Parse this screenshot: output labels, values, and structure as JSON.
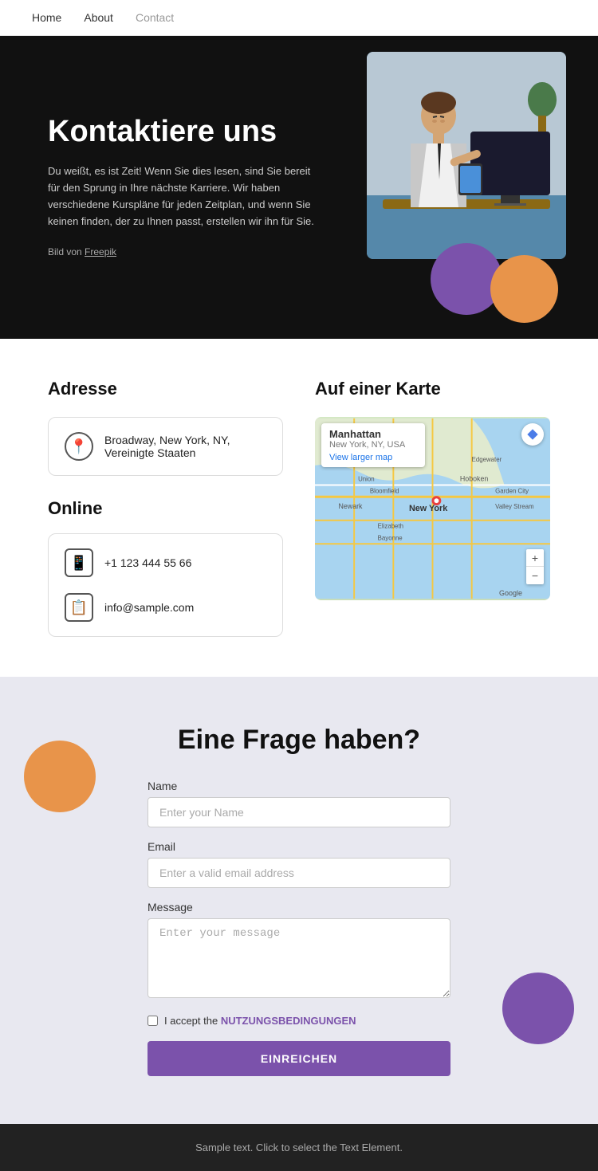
{
  "nav": {
    "links": [
      {
        "label": "Home",
        "active": false
      },
      {
        "label": "About",
        "active": false
      },
      {
        "label": "Contact",
        "active": true
      }
    ]
  },
  "hero": {
    "title": "Kontaktiere uns",
    "body": "Du weißt, es ist Zeit! Wenn Sie dies lesen, sind Sie bereit für den Sprung in Ihre nächste Karriere. Wir haben verschiedene Kurspläne für jeden Zeitplan, und wenn Sie keinen finden, der zu Ihnen passt, erstellen wir ihn für Sie.",
    "credit_prefix": "Bild von ",
    "credit_link": "Freepik"
  },
  "address_section": {
    "title": "Adresse",
    "address_text": "Broadway, New York, NY, Vereinigte Staaten"
  },
  "online_section": {
    "title": "Online",
    "phone": "+1 123 444 55 66",
    "email": "info@sample.com"
  },
  "map_section": {
    "title": "Auf einer Karte",
    "place_name": "Manhattan",
    "place_sub": "New York, NY, USA",
    "view_larger": "View larger map",
    "directions": "Directions"
  },
  "form_section": {
    "title": "Eine Frage haben?",
    "name_label": "Name",
    "name_placeholder": "Enter your Name",
    "email_label": "Email",
    "email_placeholder": "Enter a valid email address",
    "message_label": "Message",
    "message_placeholder": "Enter your message",
    "terms_prefix": "I accept the ",
    "terms_link": "NUTZUNGSBEDINGUNGEN",
    "submit_label": "EINREICHEN"
  },
  "footer": {
    "text": "Sample text. Click to select the Text Element."
  }
}
